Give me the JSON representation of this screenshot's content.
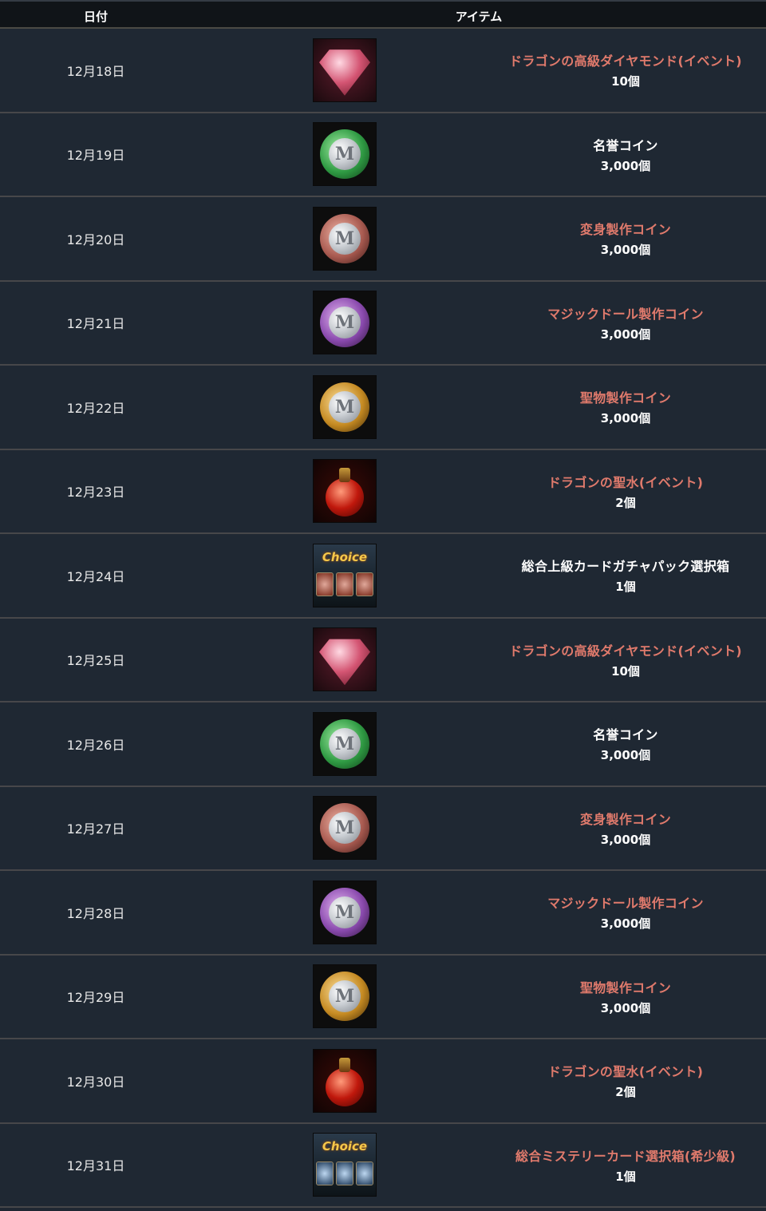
{
  "header": {
    "date_col": "日付",
    "item_col": "アイテム"
  },
  "rows": [
    {
      "date": "12月18日",
      "icon": "dragon-diamond-icon",
      "name": "ドラゴンの高級ダイヤモンド(イベント)",
      "qty": "10個",
      "highlight": true
    },
    {
      "date": "12月19日",
      "icon": "honor-coin-icon",
      "name": "名誉コイン",
      "qty": "3,000個",
      "highlight": false
    },
    {
      "date": "12月20日",
      "icon": "transform-coin-icon",
      "name": "変身製作コイン",
      "qty": "3,000個",
      "highlight": true
    },
    {
      "date": "12月21日",
      "icon": "magic-doll-coin-icon",
      "name": "マジックドール製作コイン",
      "qty": "3,000個",
      "highlight": true
    },
    {
      "date": "12月22日",
      "icon": "relic-coin-icon",
      "name": "聖物製作コイン",
      "qty": "3,000個",
      "highlight": true
    },
    {
      "date": "12月23日",
      "icon": "dragon-holy-water-icon",
      "name": "ドラゴンの聖水(イベント)",
      "qty": "2個",
      "highlight": true
    },
    {
      "date": "12月24日",
      "icon": "choice-card-box-icon",
      "name": "総合上級カードガチャパック選択箱",
      "qty": "1個",
      "highlight": false
    },
    {
      "date": "12月25日",
      "icon": "dragon-diamond-icon",
      "name": "ドラゴンの高級ダイヤモンド(イベント)",
      "qty": "10個",
      "highlight": true
    },
    {
      "date": "12月26日",
      "icon": "honor-coin-icon",
      "name": "名誉コイン",
      "qty": "3,000個",
      "highlight": false
    },
    {
      "date": "12月27日",
      "icon": "transform-coin-icon",
      "name": "変身製作コイン",
      "qty": "3,000個",
      "highlight": true
    },
    {
      "date": "12月28日",
      "icon": "magic-doll-coin-icon",
      "name": "マジックドール製作コイン",
      "qty": "3,000個",
      "highlight": true
    },
    {
      "date": "12月29日",
      "icon": "relic-coin-icon",
      "name": "聖物製作コイン",
      "qty": "3,000個",
      "highlight": true
    },
    {
      "date": "12月30日",
      "icon": "dragon-holy-water-icon",
      "name": "ドラゴンの聖水(イベント)",
      "qty": "2個",
      "highlight": true
    },
    {
      "date": "12月31日",
      "icon": "choice-mystery-card-box-icon",
      "name": "総合ミステリーカード選択箱(希少級)",
      "qty": "1個",
      "highlight": true
    }
  ],
  "icon_labels": {
    "choice": "Choice",
    "coin_glyph": "M"
  },
  "colors": {
    "background": "#1f2732",
    "highlight_text": "#e07a6c",
    "normal_text": "#ffffff"
  }
}
